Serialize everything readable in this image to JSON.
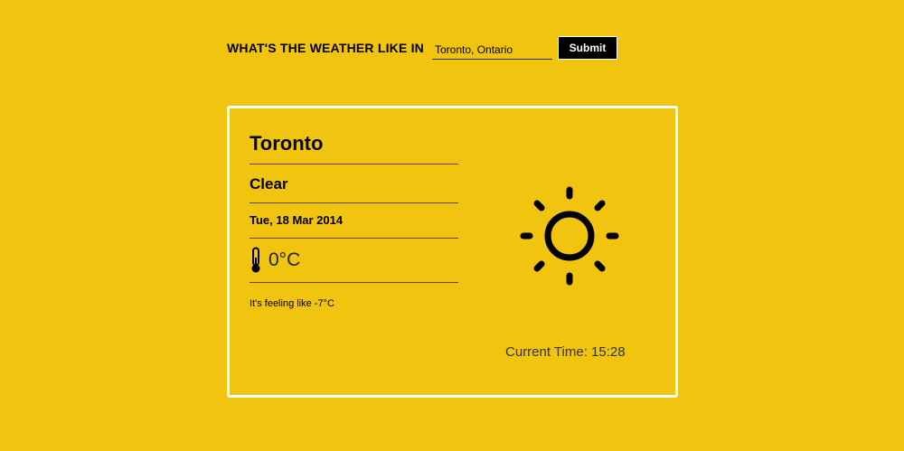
{
  "search": {
    "label": "WHAT'S THE WEATHER LIKE IN",
    "value": "Toronto, Ontario",
    "submit_label": "Submit"
  },
  "weather": {
    "city": "Toronto",
    "condition": "Clear",
    "date": "Tue, 18 Mar 2014",
    "temperature": "0°C",
    "feels_like": "It's feeling like -7°C",
    "icon": "sun-icon",
    "current_time": "Current Time: 15:28"
  },
  "colors": {
    "background": "#f1c40f",
    "card_border": "#ffffff",
    "button_bg": "#000000",
    "button_text": "#ffffff"
  }
}
